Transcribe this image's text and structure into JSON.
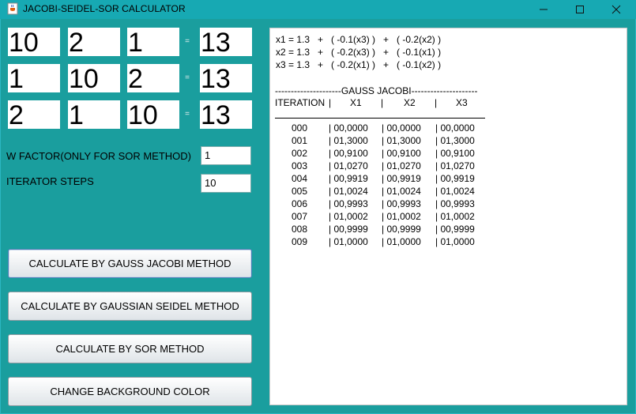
{
  "window": {
    "title": "JACOBI-SEIDEL-SOR CALCULATOR"
  },
  "matrix": [
    [
      "10",
      "2",
      "1",
      "13"
    ],
    [
      "1",
      "10",
      "2",
      "13"
    ],
    [
      "2",
      "1",
      "10",
      "13"
    ]
  ],
  "equals_sign": "=",
  "w_factor": {
    "label": "W FACTOR(ONLY FOR SOR METHOD)",
    "value": "1"
  },
  "iterator_steps": {
    "label": "ITERATOR STEPS",
    "value": "10"
  },
  "buttons": {
    "jacobi": "CALCULATE BY GAUSS JACOBI METHOD",
    "seidel": "CALCULATE BY GAUSSIAN SEIDEL METHOD",
    "sor": "CALCULATE BY SOR METHOD",
    "bg": "CHANGE BACKGROUND COLOR"
  },
  "output": {
    "equations": [
      "x1 = 1.3   +   ( -0.1(x3) )   +   ( -0.2(x2) )",
      "x2 = 1.3   +   ( -0.2(x3) )   +   ( -0.1(x1) )",
      "x3 = 1.3   +   ( -0.2(x1) )   +   ( -0.1(x2) )"
    ],
    "method_title": "---------------------GAUSS JACOBI---------------------",
    "headers": [
      "ITERATION",
      "|",
      "X1",
      "|",
      "X2",
      "|",
      "X3"
    ],
    "rows": [
      [
        "000",
        "| 00,0000",
        "| 00,0000",
        "| 00,0000"
      ],
      [
        "001",
        "| 01,3000",
        "| 01,3000",
        "| 01,3000"
      ],
      [
        "002",
        "| 00,9100",
        "| 00,9100",
        "| 00,9100"
      ],
      [
        "003",
        "| 01,0270",
        "| 01,0270",
        "| 01,0270"
      ],
      [
        "004",
        "| 00,9919",
        "| 00,9919",
        "| 00,9919"
      ],
      [
        "005",
        "| 01,0024",
        "| 01,0024",
        "| 01,0024"
      ],
      [
        "006",
        "| 00,9993",
        "| 00,9993",
        "| 00,9993"
      ],
      [
        "007",
        "| 01,0002",
        "| 01,0002",
        "| 01,0002"
      ],
      [
        "008",
        "| 00,9999",
        "| 00,9999",
        "| 00,9999"
      ],
      [
        "009",
        "| 01,0000",
        "| 01,0000",
        "| 01,0000"
      ]
    ]
  },
  "colors": {
    "background": "#1a9e9e",
    "titlebar": "#17a9b3"
  }
}
